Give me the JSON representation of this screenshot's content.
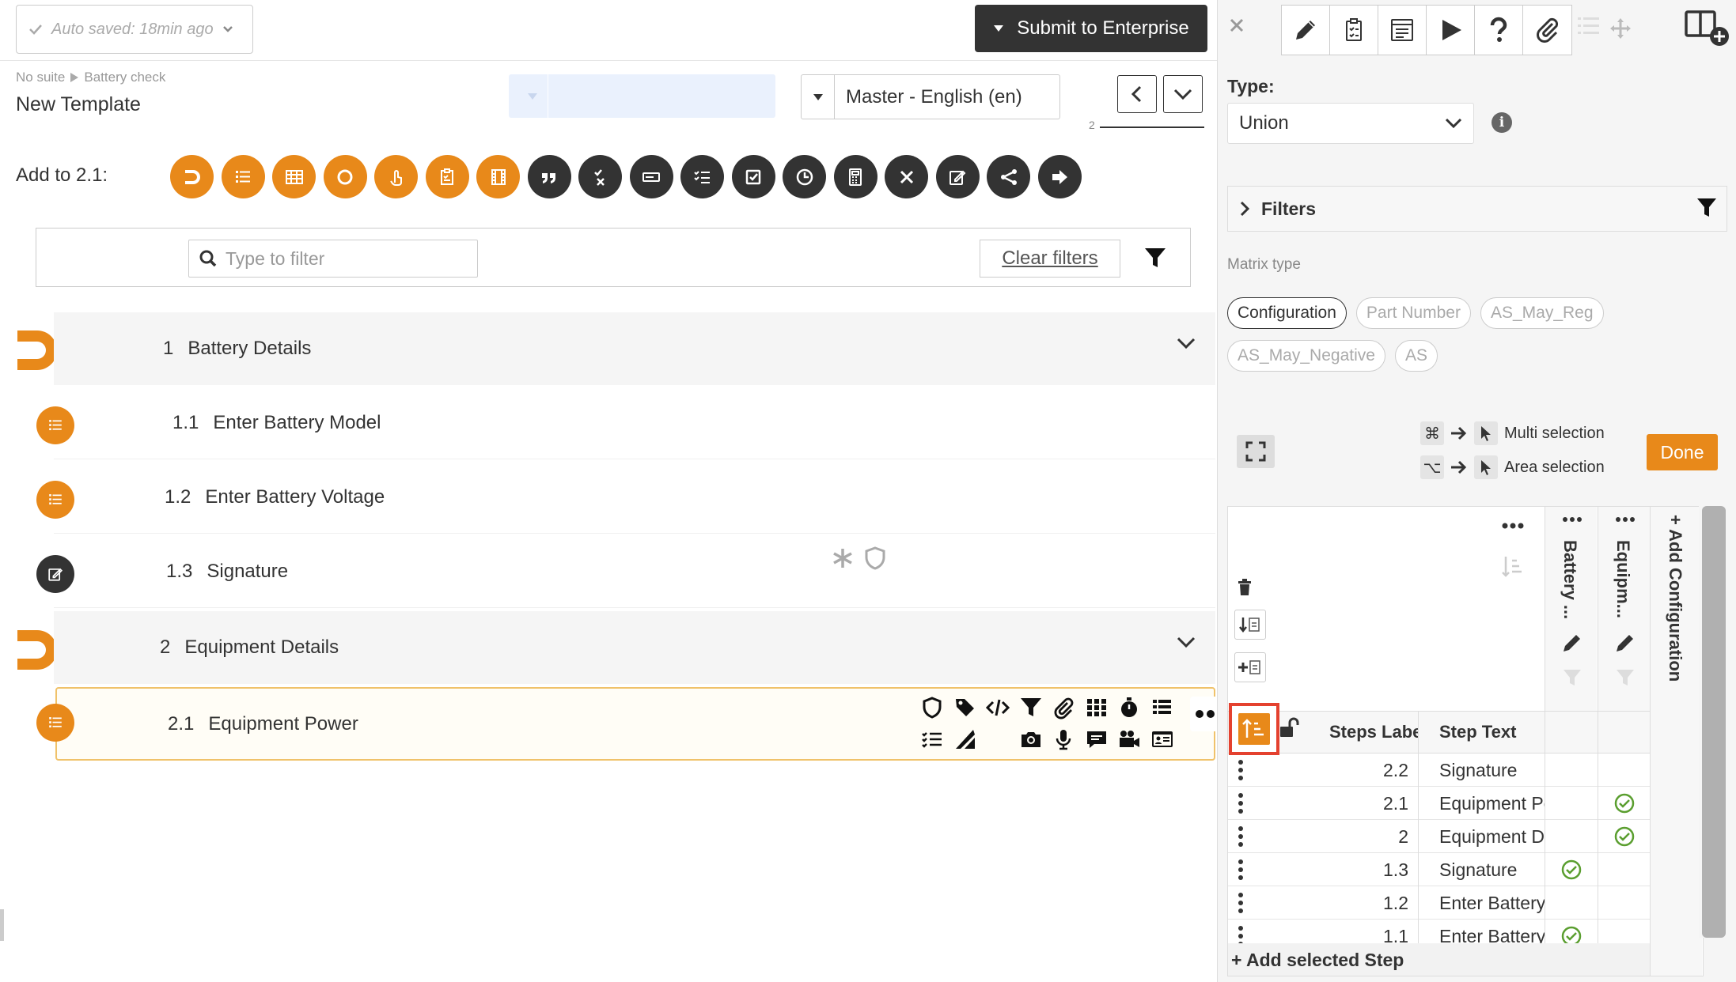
{
  "header": {
    "autosave_text": "Auto saved: 18min ago",
    "submit_label": "Submit to Enterprise"
  },
  "breadcrumb": {
    "suite": "No suite",
    "item": "Battery check"
  },
  "template_title": "New Template",
  "language": {
    "selected": "Master - English (en)"
  },
  "nav": {
    "position": "2"
  },
  "add_bar": {
    "label": "Add to 2.1:"
  },
  "filter": {
    "placeholder": "Type to filter",
    "clear_label": "Clear filters"
  },
  "sections": [
    {
      "num": "1",
      "title": "Battery Details"
    },
    {
      "num": "2",
      "title": "Equipment Details"
    }
  ],
  "steps": [
    {
      "num": "1.1",
      "title": "Enter Battery Model"
    },
    {
      "num": "1.2",
      "title": "Enter Battery Voltage"
    },
    {
      "num": "1.3",
      "title": "Signature"
    },
    {
      "num": "2.1",
      "title": "Equipment Power"
    }
  ],
  "right_panel": {
    "type_label": "Type:",
    "type_value": "Union",
    "filters_label": "Filters",
    "matrix_type_label": "Matrix type",
    "chips": [
      {
        "label": "Configuration",
        "selected": true
      },
      {
        "label": "Part Number",
        "selected": false
      },
      {
        "label": "AS_May_Reg",
        "selected": false
      },
      {
        "label": "AS_May_Negative",
        "selected": false
      },
      {
        "label": "AS",
        "selected": false
      }
    ],
    "shortcut_multi": "Multi selection",
    "shortcut_area": "Area selection",
    "done_label": "Done",
    "matrix": {
      "col1_header": "Battery ...",
      "col2_header": "Equipm...",
      "add_config_label": "+ Add Configuration",
      "steps_label_header": "Steps Label",
      "step_text_header": "Step Text",
      "rows": [
        {
          "label": "2.2",
          "text": "Signature",
          "c1": false,
          "c2": false
        },
        {
          "label": "2.1",
          "text": "Equipment Power",
          "c1": false,
          "c2": true
        },
        {
          "label": "2",
          "text": "Equipment Details",
          "c1": false,
          "c2": true
        },
        {
          "label": "1.3",
          "text": "Signature",
          "c1": true,
          "c2": false
        },
        {
          "label": "1.2",
          "text": "Enter Battery Voltage",
          "c1": false,
          "c2": false
        },
        {
          "label": "1.1",
          "text": "Enter Battery Model",
          "c1": true,
          "c2": false
        }
      ],
      "add_selected_label": "+ Add selected Step"
    }
  },
  "colors": {
    "accent_orange": "#e8891a",
    "dark": "#333333",
    "check_green": "#5a9e2f",
    "highlight_red": "#e4412f"
  }
}
